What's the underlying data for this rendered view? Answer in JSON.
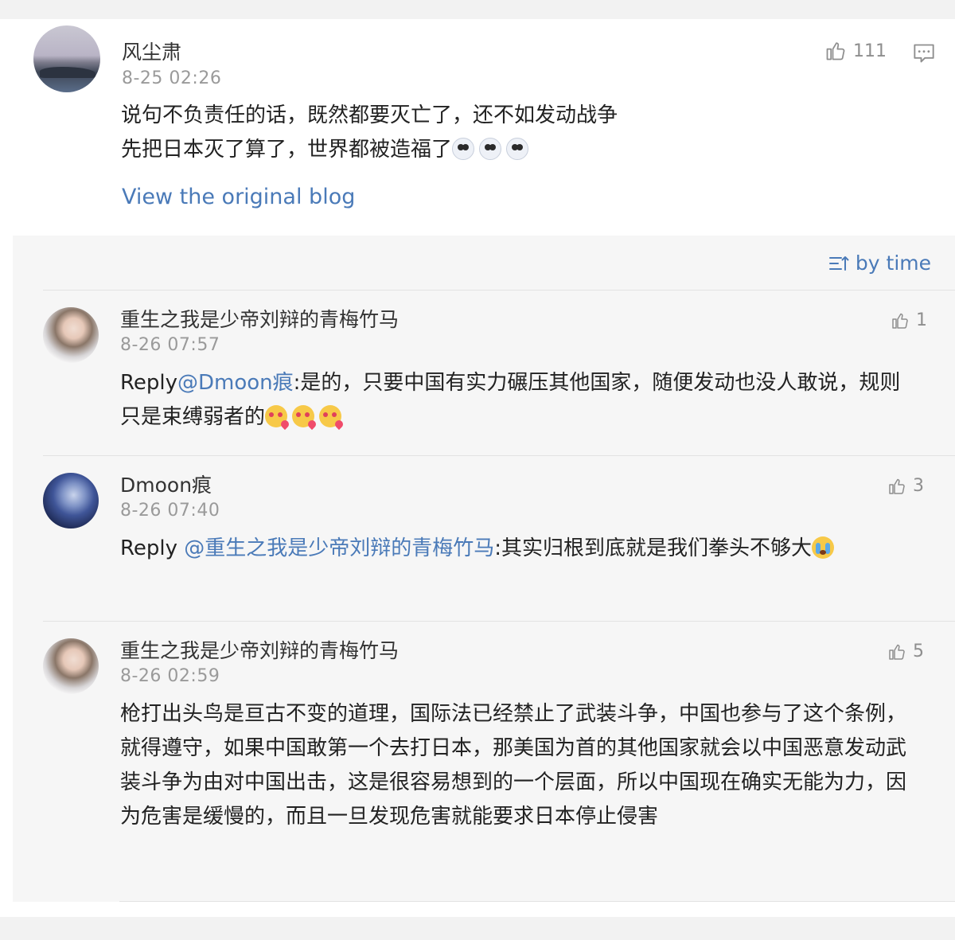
{
  "post": {
    "username": "风尘肃",
    "time": "8-25 02:26",
    "text_line1": "说句不负责任的话，既然都要灭亡了，还不如发动战争",
    "text_line2": "先把日本灭了算了，世界都被造福了",
    "emojis": [
      "ghost-emoji",
      "ghost-emoji",
      "ghost-emoji"
    ],
    "likes": "111",
    "view_original": "View the original blog"
  },
  "replies": {
    "sort_label": "by time",
    "items": [
      {
        "username": "重生之我是少帝刘辩的青梅竹马",
        "time": "8-26 07:57",
        "likes": "1",
        "prefix": "Reply",
        "mention": "@Dmoon痕",
        "text": ":是的，只要中国有实力碾压其他国家，随便发动也没人敢说，规则只是束缚弱者的",
        "emojis": [
          "love-emoji",
          "love-emoji",
          "love-emoji"
        ]
      },
      {
        "username": "Dmoon痕",
        "time": "8-26 07:40",
        "likes": "3",
        "prefix": "Reply ",
        "mention": "@重生之我是少帝刘辩的青梅竹马",
        "text": ":其实归根到底就是我们拳头不够大",
        "emojis": [
          "crying-emoji"
        ]
      },
      {
        "username": "重生之我是少帝刘辩的青梅竹马",
        "time": "8-26 02:59",
        "likes": "5",
        "text": "枪打出头鸟是亘古不变的道理，国际法已经禁止了武装斗争，中国也参与了这个条例，就得遵守，如果中国敢第一个去打日本，那美国为首的其他国家就会以中国恶意发动武装斗争为由对中国出击，这是很容易想到的一个层面，所以中国现在确实无能为力，因为危害是缓慢的，而且一旦发现危害就能要求日本停止侵害"
      }
    ]
  },
  "colors": {
    "link": "#4a7ab8",
    "muted": "#9a9a9a",
    "panel_bg": "#f6f6f6"
  }
}
